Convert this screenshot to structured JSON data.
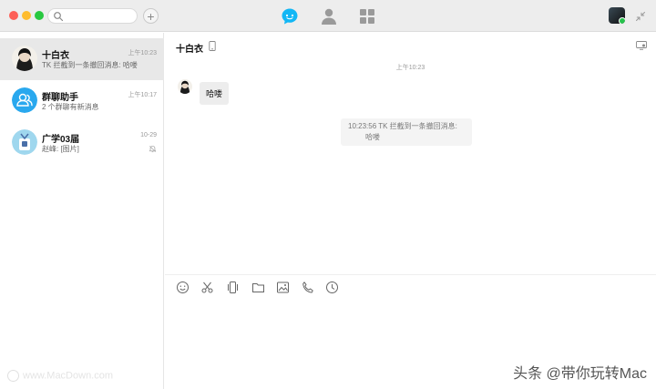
{
  "titlebar": {
    "search_icon": "search-icon",
    "add_icon": "plus-icon",
    "add_label": "+",
    "nav": [
      {
        "id": "chat",
        "icon": "chat-bubble-icon",
        "active": true
      },
      {
        "id": "contacts",
        "icon": "person-icon",
        "active": false
      },
      {
        "id": "apps",
        "icon": "grid-icon",
        "active": false
      }
    ],
    "accent_color": "#12b7f5"
  },
  "conversations": [
    {
      "name": "十白衣",
      "time": "上午10:23",
      "preview": "TK 拦截到一条撤回消息: 哈喽",
      "active": true
    },
    {
      "name": "群聊助手",
      "time": "上午10:17",
      "preview": "2 个群聊有新消息",
      "active": false
    },
    {
      "name": "广学03届",
      "time": "10-29",
      "preview": "赵峰: [图片]",
      "active": false,
      "muted": true
    }
  ],
  "chat": {
    "title": "十白衣",
    "timestamp": "上午10:23",
    "message": "哈喽",
    "system_notice_line1": "10:23:56 TK 拦截到一条撤回消息:",
    "system_notice_line2": "哈喽",
    "toolbar_icons": [
      "emoji-icon",
      "scissors-icon",
      "shake-icon",
      "folder-icon",
      "image-icon",
      "phone-icon",
      "history-clock-icon"
    ]
  },
  "watermarks": {
    "left": "www.MacDown.com",
    "right": "头条 @带你玩转Mac"
  }
}
